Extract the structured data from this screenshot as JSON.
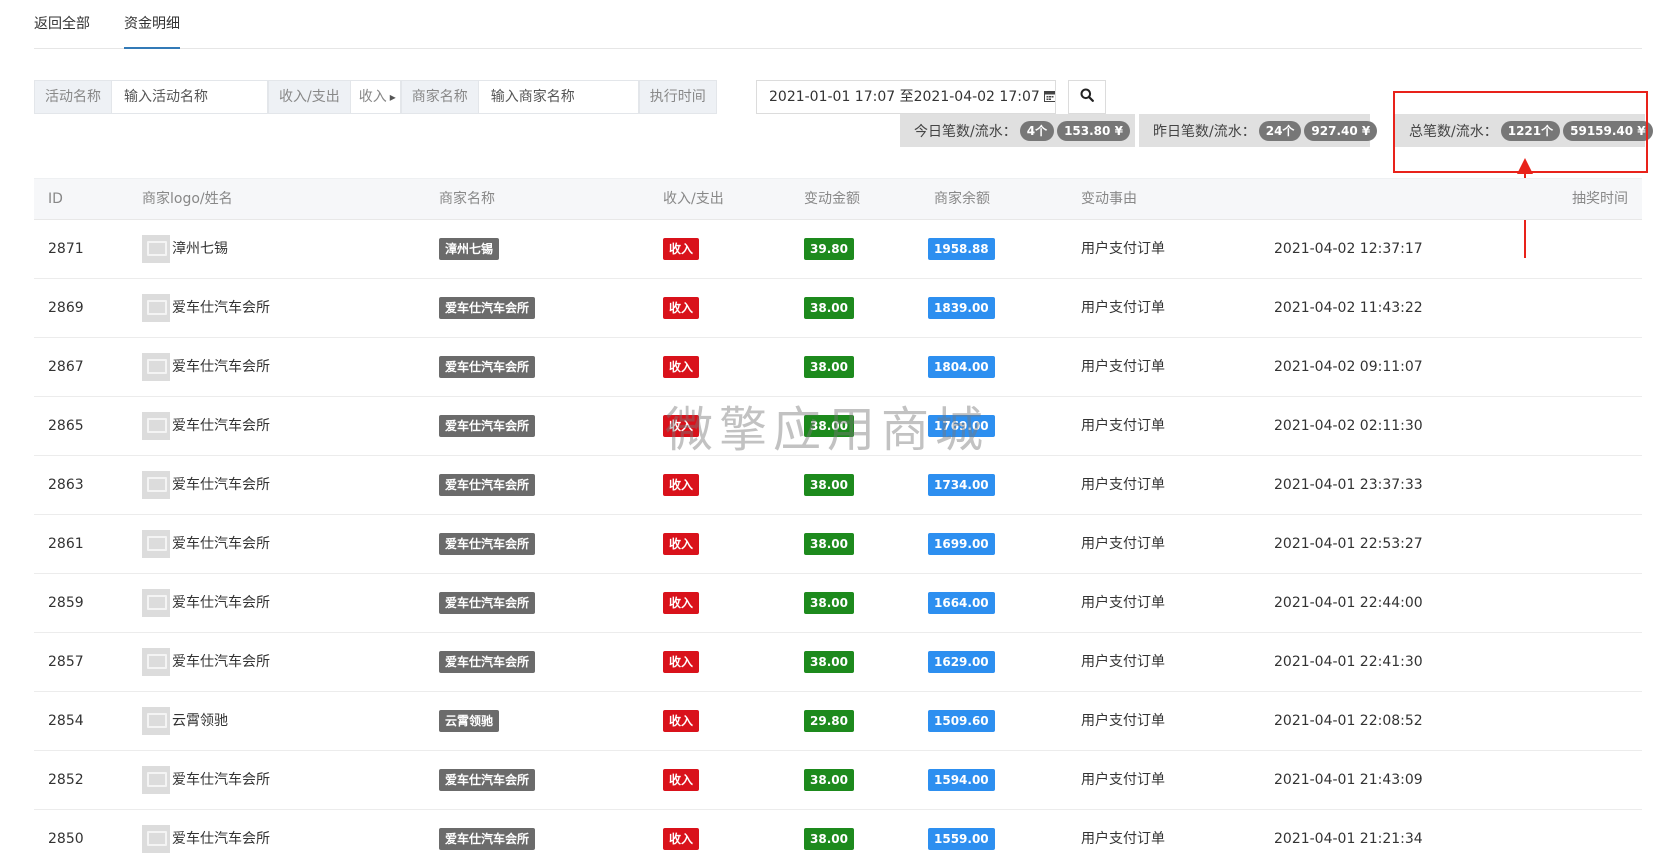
{
  "tabs": [
    {
      "label": "返回全部"
    },
    {
      "label": "资金明细"
    }
  ],
  "filters": {
    "activity_label": "活动名称",
    "activity_placeholder": "输入活动名称",
    "type_label": "收入/支出",
    "type_value": "收入",
    "merchant_label": "商家名称",
    "merchant_placeholder": "输入商家名称",
    "time_label": "执行时间",
    "date_range": "2021-01-01 17:07 至2021-04-02 17:07"
  },
  "stats": {
    "today_label": "今日笔数/流水：",
    "today_count": "4个",
    "today_amount": "153.80 ¥",
    "yesterday_label": "昨日笔数/流水：",
    "yesterday_count": "24个",
    "yesterday_amount": "927.40 ¥",
    "total_label": "总笔数/流水：",
    "total_count": "1221个",
    "total_amount": "59159.40 ¥"
  },
  "table": {
    "headers": [
      "ID",
      "商家logo/姓名",
      "商家名称",
      "收入/支出",
      "变动金额",
      "商家余额",
      "变动事由",
      "抽奖时间"
    ],
    "rows": [
      {
        "id": "2871",
        "name": "漳州七锡",
        "merchant": "漳州七锡",
        "type": "收入",
        "amount": "39.80",
        "balance": "1958.88",
        "reason": "用户支付订单",
        "time": "2021-04-02 12:37:17"
      },
      {
        "id": "2869",
        "name": "爱车仕汽车会所",
        "merchant": "爱车仕汽车会所",
        "type": "收入",
        "amount": "38.00",
        "balance": "1839.00",
        "reason": "用户支付订单",
        "time": "2021-04-02 11:43:22"
      },
      {
        "id": "2867",
        "name": "爱车仕汽车会所",
        "merchant": "爱车仕汽车会所",
        "type": "收入",
        "amount": "38.00",
        "balance": "1804.00",
        "reason": "用户支付订单",
        "time": "2021-04-02 09:11:07"
      },
      {
        "id": "2865",
        "name": "爱车仕汽车会所",
        "merchant": "爱车仕汽车会所",
        "type": "收入",
        "amount": "38.00",
        "balance": "1769.00",
        "reason": "用户支付订单",
        "time": "2021-04-02 02:11:30"
      },
      {
        "id": "2863",
        "name": "爱车仕汽车会所",
        "merchant": "爱车仕汽车会所",
        "type": "收入",
        "amount": "38.00",
        "balance": "1734.00",
        "reason": "用户支付订单",
        "time": "2021-04-01 23:37:33"
      },
      {
        "id": "2861",
        "name": "爱车仕汽车会所",
        "merchant": "爱车仕汽车会所",
        "type": "收入",
        "amount": "38.00",
        "balance": "1699.00",
        "reason": "用户支付订单",
        "time": "2021-04-01 22:53:27"
      },
      {
        "id": "2859",
        "name": "爱车仕汽车会所",
        "merchant": "爱车仕汽车会所",
        "type": "收入",
        "amount": "38.00",
        "balance": "1664.00",
        "reason": "用户支付订单",
        "time": "2021-04-01 22:44:00"
      },
      {
        "id": "2857",
        "name": "爱车仕汽车会所",
        "merchant": "爱车仕汽车会所",
        "type": "收入",
        "amount": "38.00",
        "balance": "1629.00",
        "reason": "用户支付订单",
        "time": "2021-04-01 22:41:30"
      },
      {
        "id": "2854",
        "name": "云霄领驰",
        "merchant": "云霄领驰",
        "type": "收入",
        "amount": "29.80",
        "balance": "1509.60",
        "reason": "用户支付订单",
        "time": "2021-04-01 22:08:52"
      },
      {
        "id": "2852",
        "name": "爱车仕汽车会所",
        "merchant": "爱车仕汽车会所",
        "type": "收入",
        "amount": "38.00",
        "balance": "1594.00",
        "reason": "用户支付订单",
        "time": "2021-04-01 21:43:09"
      },
      {
        "id": "2850",
        "name": "爱车仕汽车会所",
        "merchant": "爱车仕汽车会所",
        "type": "收入",
        "amount": "38.00",
        "balance": "1559.00",
        "reason": "用户支付订单",
        "time": "2021-04-01 21:21:34"
      }
    ]
  },
  "watermark": "微擎应用商城",
  "colors": {
    "income_red": "#d9121b",
    "amount_green": "#1d8a1d",
    "balance_blue": "#2d8ff0",
    "merchant_gray": "#6b6b6b",
    "highlight_red": "#e8221a"
  },
  "icons": {
    "calendar": "calendar-icon",
    "search": "search-icon",
    "image_placeholder": "image-placeholder-icon"
  }
}
